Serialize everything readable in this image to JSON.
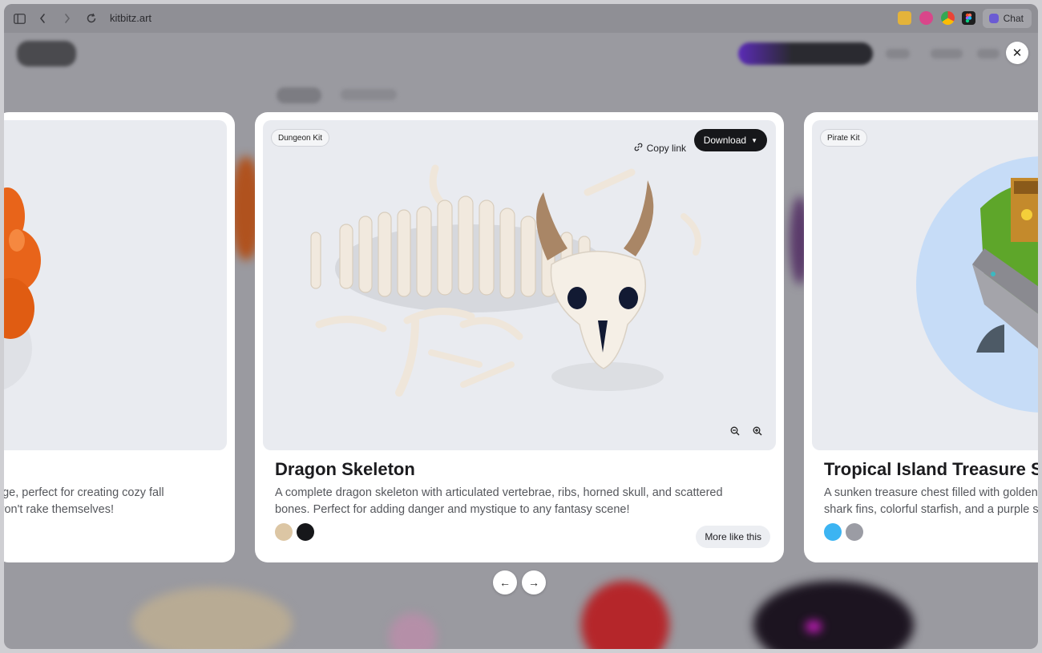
{
  "browser": {
    "url": "kitbitz.art",
    "chat_label": "Chat",
    "icons": [
      "sidebar-icon",
      "back-icon",
      "forward-icon",
      "reload-icon"
    ]
  },
  "modal": {
    "close_icon": "close-icon",
    "prev_icon": "arrow-left-icon",
    "next_icon": "arrow-right-icon"
  },
  "cards": {
    "left": {
      "desc_line1": "age, perfect for creating cozy fall",
      "desc_line2": "won't rake themselves!"
    },
    "center": {
      "kit": "Dungeon Kit",
      "copy_link": "Copy link",
      "download": "Download",
      "title": "Dragon Skeleton",
      "description": "A complete dragon skeleton with articulated vertebrae, ribs, horned skull, and scattered bones. Perfect for adding danger and mystique to any fantasy scene!",
      "swatches": [
        "#dcc6a4",
        "#16171a"
      ],
      "more_like_this": "More like this"
    },
    "right": {
      "kit": "Pirate Kit",
      "title": "Tropical Island Treasure Sce",
      "desc_line1": "A sunken treasure chest filled with golden",
      "desc_line2": "shark fins, colorful starfish, and a purple se",
      "swatches": [
        "#3cb4f2",
        "#9b9ca4"
      ]
    }
  }
}
